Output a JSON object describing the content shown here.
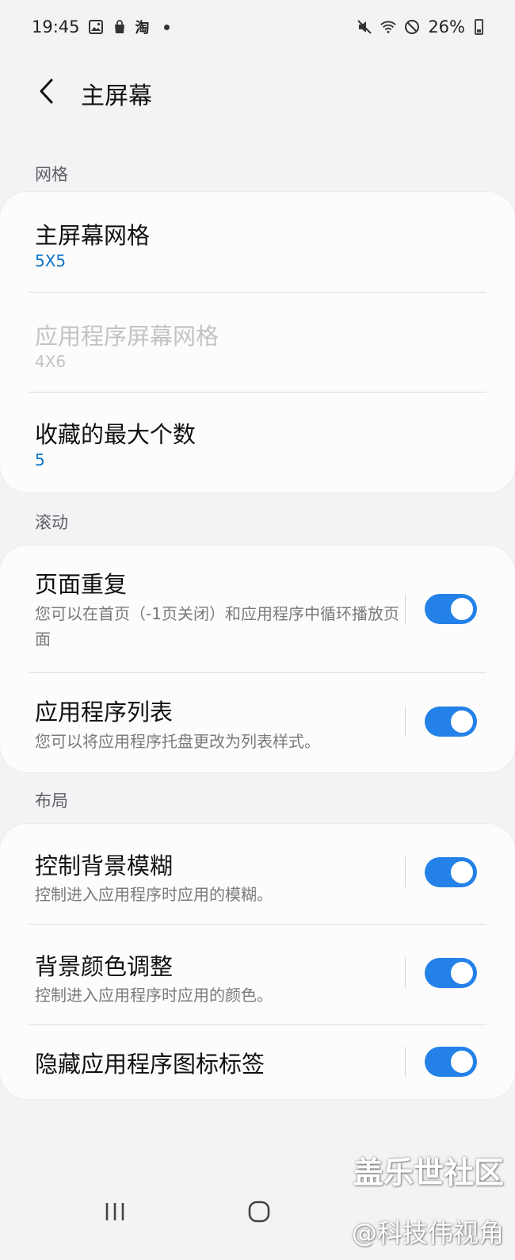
{
  "status_bar": {
    "time": "19:45",
    "taobao_glyph": "淘",
    "battery": "26%"
  },
  "header": {
    "title": "主屏幕"
  },
  "sections": {
    "grid": {
      "label": "网格",
      "home_grid_title": "主屏幕网格",
      "home_grid_value": "5X5",
      "apps_grid_title": "应用程序屏幕网格",
      "apps_grid_value": "4X6",
      "favorites_title": "收藏的最大个数",
      "favorites_value": "5"
    },
    "scroll": {
      "label": "滚动",
      "page_repeat_title": "页面重复",
      "page_repeat_desc": "您可以在首页（-1页关闭）和应用程序中循环播放页面",
      "page_repeat_on": true,
      "app_list_title": "应用程序列表",
      "app_list_desc": "您可以将应用程序托盘更改为列表样式。",
      "app_list_on": true
    },
    "layout": {
      "label": "布局",
      "blur_title": "控制背景模糊",
      "blur_desc": "控制进入应用程序时应用的模糊。",
      "blur_on": true,
      "color_title": "背景颜色调整",
      "color_desc": "控制进入应用程序时应用的颜色。",
      "color_on": true,
      "hide_labels_title": "隐藏应用程序图标标签",
      "hide_labels_on": true
    }
  },
  "watermark": {
    "line1": "盖乐世社区",
    "line2": "@科技伟视角"
  },
  "colors": {
    "accent": "#2481e8",
    "value_blue": "#0a74c9",
    "background": "#f3f3f5"
  }
}
